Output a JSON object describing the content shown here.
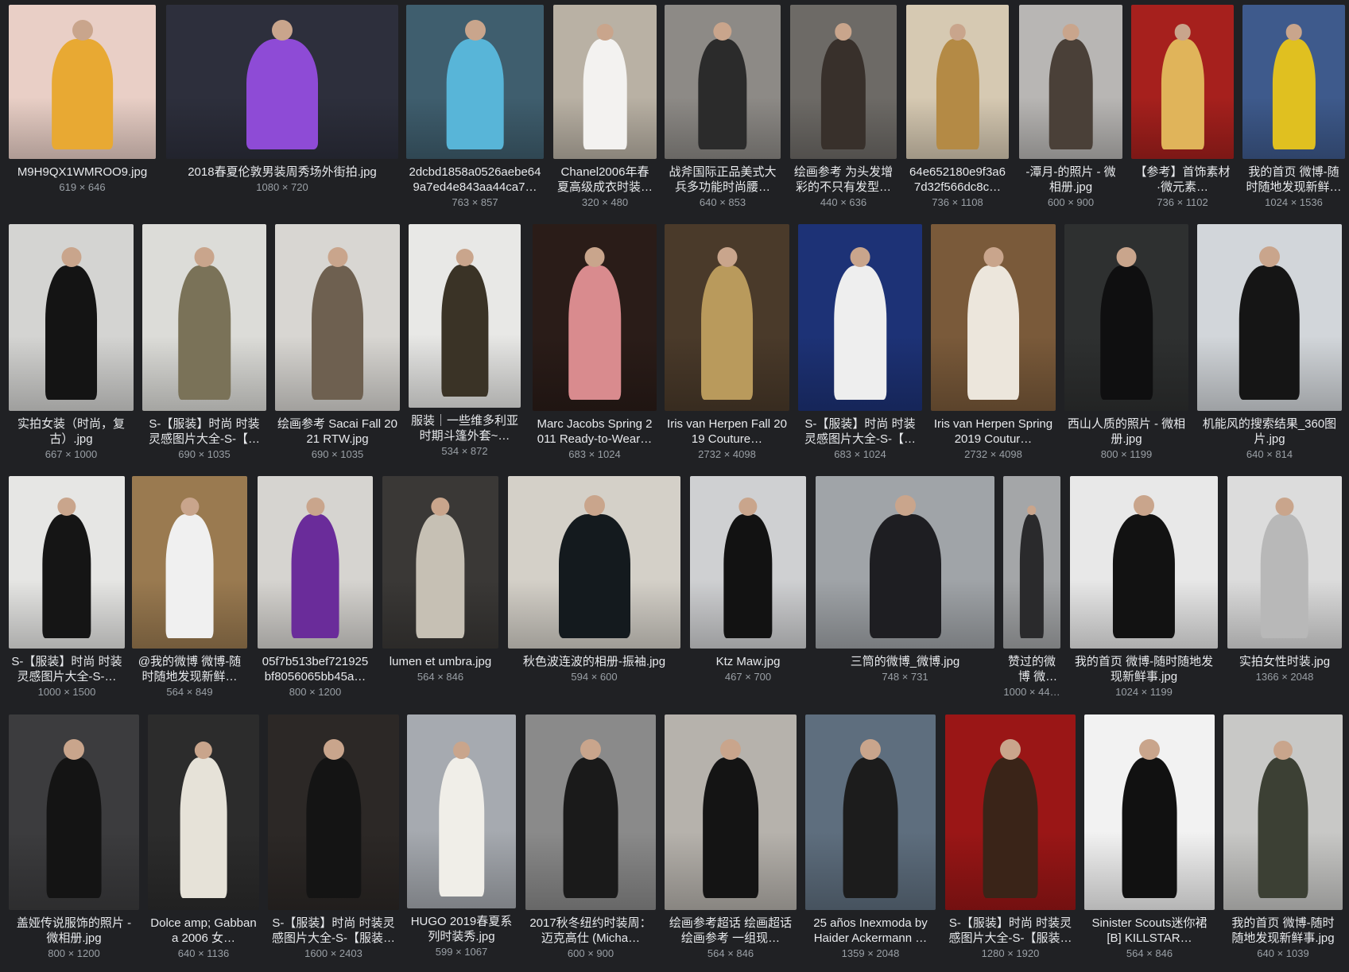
{
  "rows": [
    [
      {
        "caption": "M9H9QX1WMROO9.jpg",
        "dims": "619 × 646",
        "bg": "#e9cfc6",
        "fg": "#e8a933"
      },
      {
        "caption": "2018春夏伦敦男装周秀场外街拍.jpg",
        "dims": "1080 × 720",
        "bg": "#2d2f3c",
        "fg": "#8e4bd6"
      },
      {
        "caption": "2dcbd1858a0526aebe649a7ed4e843aa44ca7…",
        "dims": "763 × 857",
        "bg": "#3f5e6e",
        "fg": "#58b5d8"
      },
      {
        "caption": "Chanel2006年春夏高级成衣时装…",
        "dims": "320 × 480",
        "bg": "#b9b1a4",
        "fg": "#f3f2f0"
      },
      {
        "caption": "战斧国际正品美式大兵多功能时尚腰…",
        "dims": "640 × 853",
        "bg": "#8d8a86",
        "fg": "#2b2b2b"
      },
      {
        "caption": "绘画参考 为头发增彩的不只有发型…",
        "dims": "440 × 636",
        "bg": "#6d6a66",
        "fg": "#38302b"
      },
      {
        "caption": "64e652180e9f3a67d32f566dc8c…",
        "dims": "736 × 1108",
        "bg": "#d6c9b2",
        "fg": "#b48a45"
      },
      {
        "caption": "-潭月-的照片 - 微相册.jpg",
        "dims": "600 × 900",
        "bg": "#b8b6b4",
        "fg": "#4a4038"
      },
      {
        "caption": "【参考】首饰素材·微元素…",
        "dims": "736 × 1102",
        "bg": "#a6201d",
        "fg": "#e0b45a"
      },
      {
        "caption": "我的首页 微博-随时随地发现新鲜…",
        "dims": "1024 × 1536",
        "bg": "#3e5a8c",
        "fg": "#e0c020"
      }
    ],
    [
      {
        "caption": "实拍女装（时尚，复古）.jpg",
        "dims": "667 × 1000",
        "bg": "#d4d4d2",
        "fg": "#141414"
      },
      {
        "caption": "S-【服装】时尚 时装灵感图片大全-S-【…",
        "dims": "690 × 1035",
        "bg": "#dcdcd8",
        "fg": "#7a7258"
      },
      {
        "caption": "绘画参考 Sacai Fall 2021 RTW.jpg",
        "dims": "690 × 1035",
        "bg": "#d8d6d2",
        "fg": "#6e6050"
      },
      {
        "caption": "服装｜一些维多利亚时期斗篷外套~…",
        "dims": "534 × 872",
        "bg": "#e8e8e6",
        "fg": "#3a3326"
      },
      {
        "caption": "Marc Jacobs Spring 2011 Ready-to-Wear…",
        "dims": "683 × 1024",
        "bg": "#2a1c18",
        "fg": "#d98b8e"
      },
      {
        "caption": "Iris van Herpen Fall 2019 Couture…",
        "dims": "2732 × 4098",
        "bg": "#4a3a2a",
        "fg": "#b99a5c"
      },
      {
        "caption": "S-【服装】时尚 时装灵感图片大全-S-【…",
        "dims": "683 × 1024",
        "bg": "#1d3276",
        "fg": "#eeeeee"
      },
      {
        "caption": "Iris van Herpen Spring 2019 Coutur…",
        "dims": "2732 × 4098",
        "bg": "#7a5a3a",
        "fg": "#ece6dc"
      },
      {
        "caption": "西山人质的照片 - 微相册.jpg",
        "dims": "800 × 1199",
        "bg": "#2e3030",
        "fg": "#0f0f10"
      },
      {
        "caption": "机能风的搜索结果_360图片.jpg",
        "dims": "640 × 814",
        "bg": "#d2d6da",
        "fg": "#151515"
      }
    ],
    [
      {
        "caption": "S-【服装】时尚 时装灵感图片大全-S-…",
        "dims": "1000 × 1500",
        "bg": "#e6e6e4",
        "fg": "#151515"
      },
      {
        "caption": "@我的微博 微博-随时随地发现新鲜…",
        "dims": "564 × 849",
        "bg": "#9a7a50",
        "fg": "#f0f0f0"
      },
      {
        "caption": "05f7b513bef721925bf8056065bb45a…",
        "dims": "800 × 1200",
        "bg": "#d6d4d0",
        "fg": "#6a2c9a"
      },
      {
        "caption": "lumen et umbra.jpg",
        "dims": "564 × 846",
        "bg": "#3a3836",
        "fg": "#c6c0b4"
      },
      {
        "caption": "秋色波连波的相册-振袖.jpg",
        "dims": "594 × 600",
        "bg": "#d4d0c8",
        "fg": "#141a1e"
      },
      {
        "caption": "Ktz Maw.jpg",
        "dims": "467 × 700",
        "bg": "#cfd0d2",
        "fg": "#121212"
      },
      {
        "caption": "三筒的微博_微博.jpg",
        "dims": "748 × 731",
        "bg": "#a0a4a8",
        "fg": "#1e1e22"
      },
      {
        "caption": "赞过的微博 微博-…",
        "dims": "1000 × 44…",
        "bg": "#a4a6a8",
        "fg": "#2a2a2c"
      },
      {
        "caption": "我的首页 微博-随时随地发现新鲜事.jpg",
        "dims": "1024 × 1199",
        "bg": "#e8e8e8",
        "fg": "#121212"
      },
      {
        "caption": "实拍女性时装.jpg",
        "dims": "1366 × 2048",
        "bg": "#dcdcdc",
        "fg": "#b8b8b8"
      }
    ],
    [
      {
        "caption": "盖娅传说服饰的照片 - 微相册.jpg",
        "dims": "800 × 1200",
        "bg": "#3c3c3e",
        "fg": "#141414"
      },
      {
        "caption": "Dolce amp; Gabbana 2006 女…",
        "dims": "640 × 1136",
        "bg": "#2c2c2c",
        "fg": "#e6e2d8"
      },
      {
        "caption": "S-【服装】时尚 时装灵感图片大全-S-【服装…",
        "dims": "1600 × 2403",
        "bg": "#2c2826",
        "fg": "#141414"
      },
      {
        "caption": "HUGO 2019春夏系列时装秀.jpg",
        "dims": "599 × 1067",
        "bg": "#a6aab0",
        "fg": "#f0eee8"
      },
      {
        "caption": "2017秋冬纽约时装周：迈克高仕 (Micha…",
        "dims": "600 × 900",
        "bg": "#8a8a8a",
        "fg": "#1a1a1a"
      },
      {
        "caption": "绘画参考超话 绘画超话　绘画参考 一组现…",
        "dims": "564 × 846",
        "bg": "#b6b2ac",
        "fg": "#141414"
      },
      {
        "caption": "25 años Inexmoda by Haider Ackermann …",
        "dims": "1359 × 2048",
        "bg": "#5e6e7e",
        "fg": "#1c1c1c"
      },
      {
        "caption": "S-【服装】时尚 时装灵感图片大全-S-【服装…",
        "dims": "1280 × 1920",
        "bg": "#9a1616",
        "fg": "#3a2418"
      },
      {
        "caption": "Sinister Scouts迷你裙 [B] KILLSTAR…",
        "dims": "564 × 846",
        "bg": "#f2f2f2",
        "fg": "#111111"
      },
      {
        "caption": "我的首页 微博-随时随地发现新鲜事.jpg",
        "dims": "640 × 1039",
        "bg": "#c8c8c6",
        "fg": "#3c4034"
      }
    ]
  ]
}
